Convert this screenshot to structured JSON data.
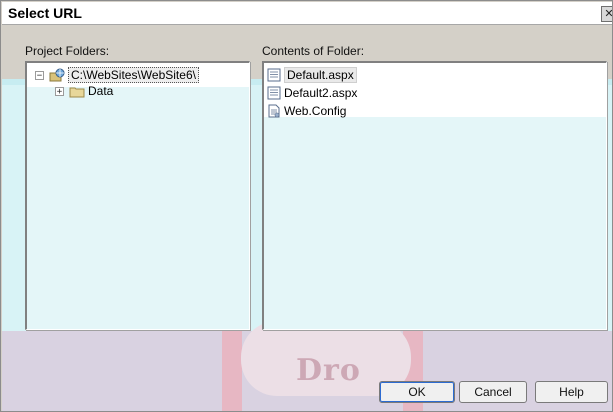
{
  "window": {
    "title": "Select URL",
    "close_glyph": "✕"
  },
  "left_panel": {
    "label": "Project Folders:",
    "tree": [
      {
        "label": "C:\\WebSites\\WebSite6\\",
        "expander": "−",
        "icon": "web-project-icon",
        "selected": true
      },
      {
        "label": "Data",
        "expander": "+",
        "icon": "folder-icon"
      }
    ]
  },
  "right_panel": {
    "label": "Contents of Folder:",
    "items": [
      {
        "label": "Default.aspx",
        "icon": "aspx-file-icon",
        "selected": true
      },
      {
        "label": "Default2.aspx",
        "icon": "aspx-file-icon"
      },
      {
        "label": "Web.Config",
        "icon": "config-file-icon"
      }
    ]
  },
  "buttons": {
    "ok": "OK",
    "cancel": "Cancel",
    "help": "Help"
  },
  "watermark": {
    "text": "Dro"
  },
  "colors": {
    "dialog_bg": "#d4d0c8",
    "panel_bg": "#ffffff",
    "focus_border": "#2c6bd1"
  }
}
